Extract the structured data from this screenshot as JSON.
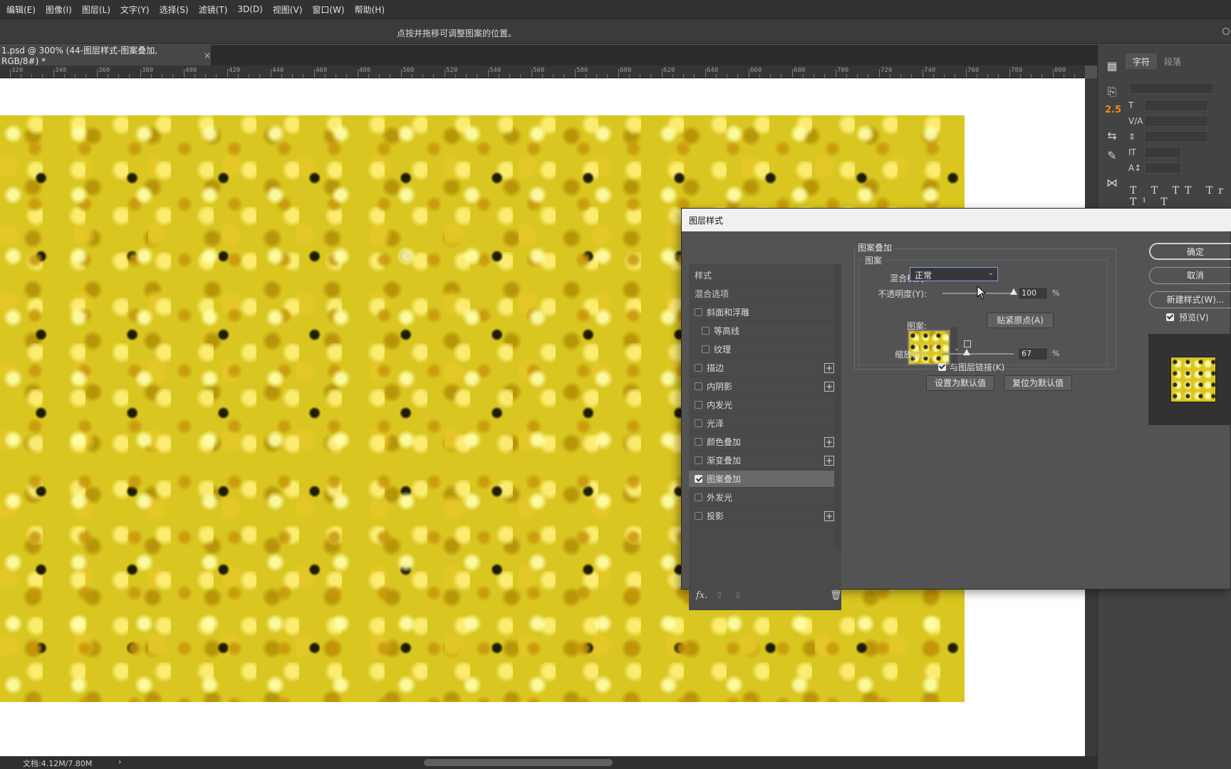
{
  "menu": [
    "编辑(E)",
    "图像(I)",
    "图层(L)",
    "文字(Y)",
    "选择(S)",
    "滤镜(T)",
    "3D(D)",
    "视图(V)",
    "窗口(W)",
    "帮助(H)"
  ],
  "options_hint": "点按并拖移可调整图案的位置。",
  "doc_tab": {
    "label": "1.psd @ 300% (44-图层样式-图案叠加, RGB/8#) *",
    "close": "×"
  },
  "ruler_ticks": [
    "320",
    "340",
    "360",
    "380",
    "400",
    "420",
    "440",
    "460",
    "480",
    "500",
    "520",
    "540",
    "560",
    "580",
    "600",
    "620",
    "640",
    "660",
    "680",
    "700",
    "720",
    "740",
    "760",
    "780",
    "800"
  ],
  "status": {
    "doc": "文档:4.12M/7.80M",
    "arrow": "›"
  },
  "toolstrip": {
    "number": "2.5"
  },
  "char_panel": {
    "tab_char": "字符",
    "tab_para": "段落",
    "typo_row": "T T TT Tr T¹ T"
  },
  "dialog": {
    "title": "图层样式",
    "style_list": {
      "header": "样式",
      "blend_options": "混合选项",
      "items": [
        {
          "label": "斜面和浮雕",
          "checked": false,
          "sub": false,
          "plus": false
        },
        {
          "label": "等高线",
          "checked": false,
          "sub": true,
          "plus": false
        },
        {
          "label": "纹理",
          "checked": false,
          "sub": true,
          "plus": false
        },
        {
          "label": "描边",
          "checked": false,
          "sub": false,
          "plus": true
        },
        {
          "label": "内阴影",
          "checked": false,
          "sub": false,
          "plus": true
        },
        {
          "label": "内发光",
          "checked": false,
          "sub": false,
          "plus": false
        },
        {
          "label": "光泽",
          "checked": false,
          "sub": false,
          "plus": false
        },
        {
          "label": "颜色叠加",
          "checked": false,
          "sub": false,
          "plus": true
        },
        {
          "label": "渐变叠加",
          "checked": false,
          "sub": false,
          "plus": true
        },
        {
          "label": "图案叠加",
          "checked": true,
          "sub": false,
          "plus": false,
          "active": true
        },
        {
          "label": "外发光",
          "checked": false,
          "sub": false,
          "plus": false
        },
        {
          "label": "投影",
          "checked": false,
          "sub": false,
          "plus": true
        }
      ],
      "footer": {
        "fx": "fx.",
        "up": "⇧",
        "down": "⇩",
        "trash": "🗑"
      }
    },
    "settings": {
      "section_title": "图案叠加",
      "group_title": "图案",
      "blend_label": "混合模式:",
      "blend_value": "正常",
      "opacity_label": "不透明度(Y):",
      "opacity_value": "100",
      "opacity_fraction": 1.0,
      "pattern_label": "图案:",
      "snap_button": "贴紧原点(A)",
      "scale_label": "缩放(S):",
      "scale_value": "67",
      "scale_fraction": 0.34,
      "percent": "%",
      "link_label": "与图层链接(K)",
      "link_checked": true,
      "set_default": "设置为默认值",
      "reset_default": "复位为默认值"
    },
    "buttons": {
      "ok": "确定",
      "cancel": "取消",
      "new_style": "新建样式(W)...",
      "preview": "预览(V)",
      "preview_checked": true
    }
  }
}
